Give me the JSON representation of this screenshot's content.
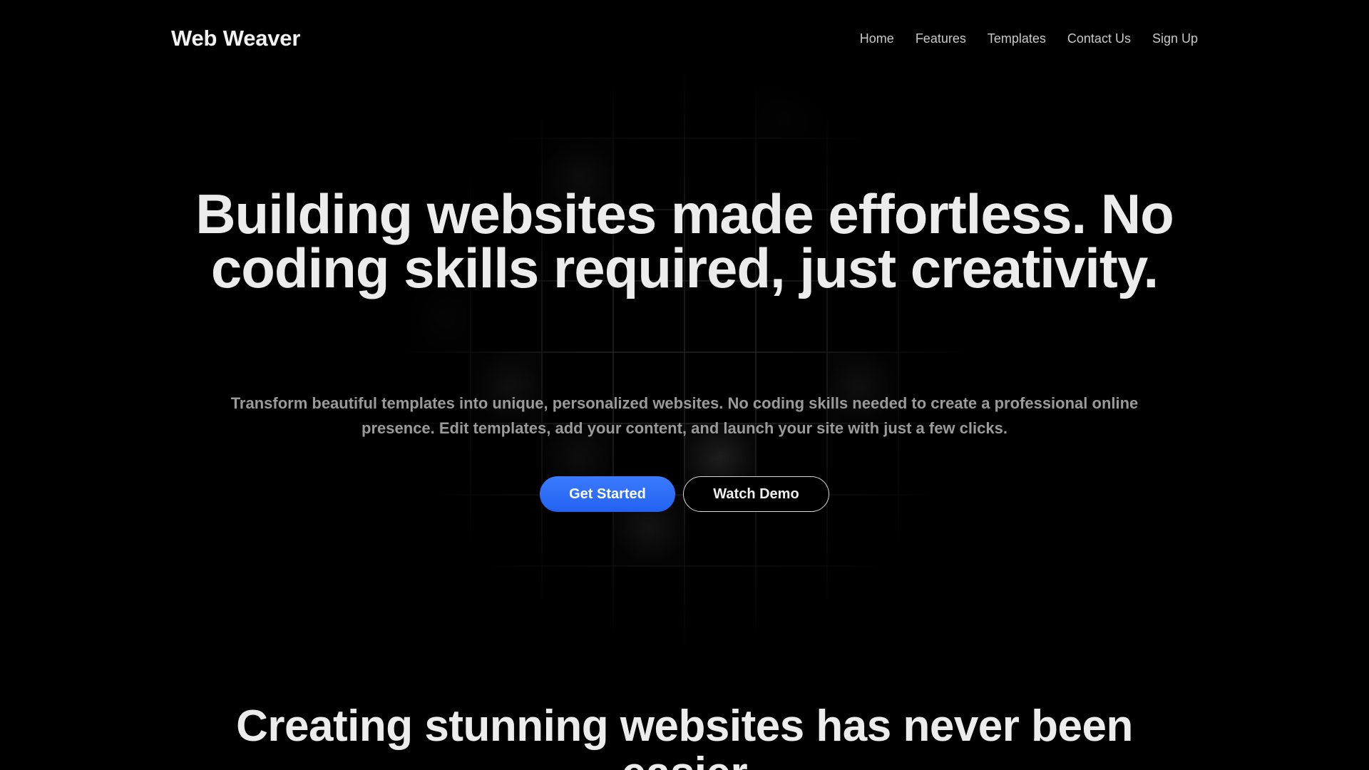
{
  "nav": {
    "brand": "Web Weaver",
    "links": [
      "Home",
      "Features",
      "Templates",
      "Contact Us",
      "Sign Up"
    ]
  },
  "hero": {
    "title": "Building websites made effortless. No coding skills required, just creativity.",
    "subtitle": "Transform beautiful templates into unique, personalized websites. No coding skills needed to create a professional online presence. Edit templates, add your content, and launch your site with just a few clicks.",
    "primary_cta": "Get Started",
    "secondary_cta": "Watch Demo"
  },
  "section": {
    "title": "Creating stunning websites has never been easier"
  },
  "colors": {
    "background": "#000000",
    "primary_button": "#2f6ff8",
    "text": "#ececec",
    "muted_text": "#9a9a9a"
  }
}
